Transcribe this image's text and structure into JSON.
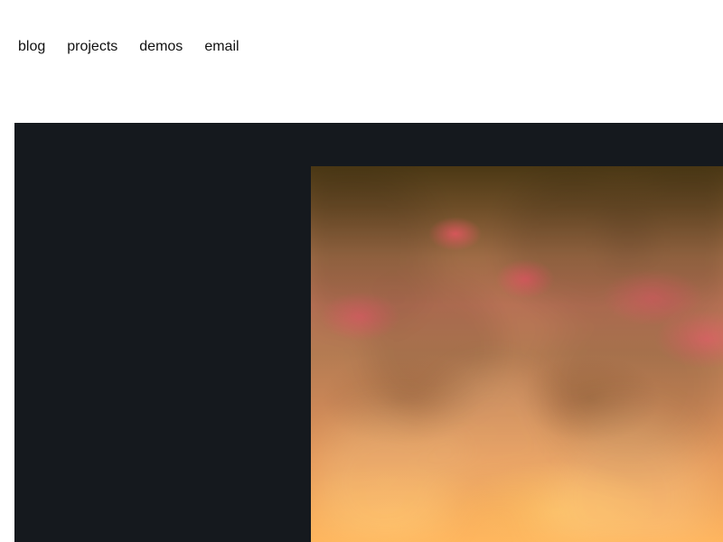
{
  "top_nav": {
    "items": [
      {
        "label": "blog"
      },
      {
        "label": "projects"
      },
      {
        "label": "demos"
      },
      {
        "label": "email"
      }
    ]
  },
  "demo": {
    "background_color": "#15191e",
    "visual": "fire-simulation"
  }
}
